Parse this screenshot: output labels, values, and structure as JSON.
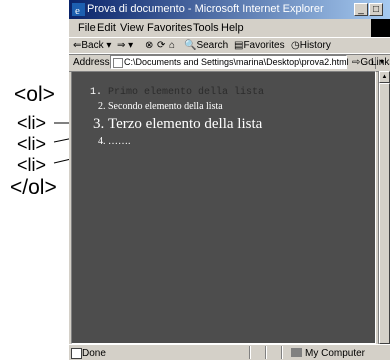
{
  "annotations": {
    "ol_open": "<ol>",
    "li": [
      "<li>",
      "<li>",
      "<li>"
    ],
    "ol_close": "</ol>"
  },
  "window": {
    "title": "Prova di documento - Microsoft Internet Explorer",
    "minimize_label": "_",
    "maximize_label": "□",
    "close_label": "×"
  },
  "menubar": {
    "items": [
      "File",
      "Edit",
      "View",
      "Favorites",
      "Tools",
      "Help"
    ]
  },
  "toolbar": {
    "back": "⇐Back ▾",
    "forward": "⇒ ▾",
    "stop": "⊗",
    "refresh": "⟳",
    "home": "⌂",
    "search": "🔍Search",
    "favorites": "▤Favorites",
    "history": "◷History"
  },
  "addressbar": {
    "label": "Address",
    "value": "C:\\Documents and Settings\\marina\\Desktop\\prova2.html",
    "go": "⇨Go",
    "links": "Links"
  },
  "content": {
    "list": [
      "Primo elemento della lista",
      "Secondo elemento della lista",
      "Terzo elemento della lista",
      "……."
    ]
  },
  "statusbar": {
    "status": "Done",
    "zone": "My Computer"
  },
  "colors": {
    "content_bg": "#4d4d4d",
    "title_gradient_start": "#0a246a"
  }
}
